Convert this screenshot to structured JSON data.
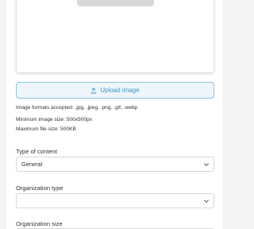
{
  "upload": {
    "button_label": "Upload image",
    "icon": "upload-icon"
  },
  "requirements": {
    "formats": "Image formats accepted: .jpg, .jpeg, .png, .gif, .webp",
    "min_size": "Minimum image size: 500x500px",
    "max_file": "Maximum file size: 500KB"
  },
  "form": {
    "content_type": {
      "label": "Type of content",
      "value": "General"
    },
    "organization_type": {
      "label": "Organization type",
      "value": ""
    },
    "organization_size": {
      "label": "Organization size"
    }
  },
  "colors": {
    "accent": "#3a97c7",
    "accent_bg": "#eef6fb",
    "border": "#d8d8d8"
  }
}
